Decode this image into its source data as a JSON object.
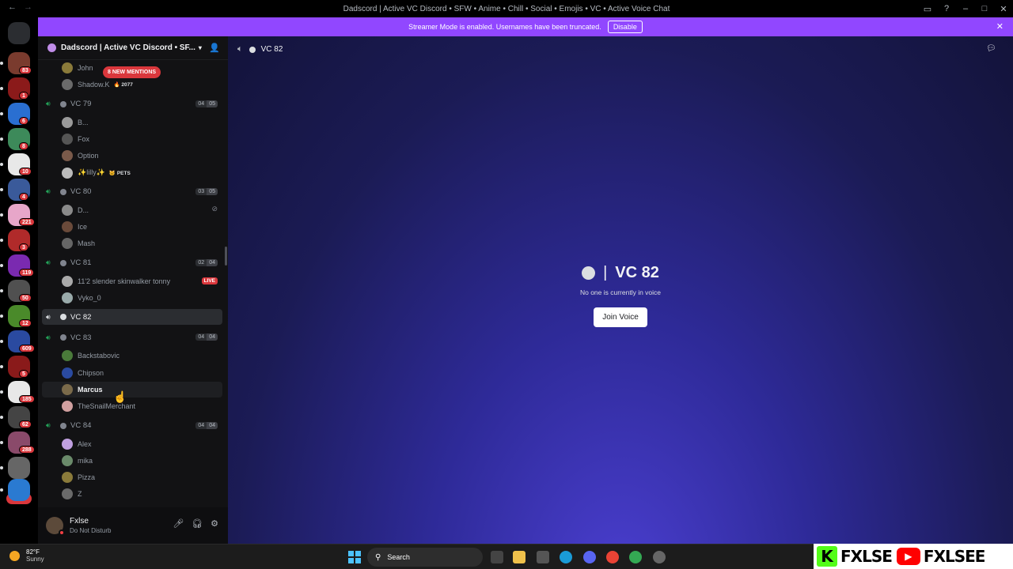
{
  "window": {
    "title": "Dadscord | Active VC Discord • SFW • Anime • Chill • Social • Emojis • VC • Active Voice Chat"
  },
  "banner": {
    "text": "Streamer Mode is enabled. Usernames have been truncated.",
    "button": "Disable"
  },
  "guilds": {
    "badges": [
      "83",
      "1",
      "6",
      "8",
      "10",
      "4",
      "221",
      "3",
      "119",
      "50",
      "12",
      "609",
      "5",
      "185",
      "62",
      "288"
    ],
    "new_label": "NEW"
  },
  "server": {
    "name": "Dadscord | Active VC Discord • SF..."
  },
  "mentions": {
    "label": "8 NEW MENTIONS"
  },
  "list": [
    {
      "type": "user",
      "name": "John"
    },
    {
      "type": "user",
      "name": "Shadow.K",
      "tag": "🔥 2077"
    },
    {
      "type": "channel",
      "name": "VC 79",
      "count_a": "04",
      "count_b": "05"
    },
    {
      "type": "user",
      "name": "B..."
    },
    {
      "type": "user",
      "name": "Fox"
    },
    {
      "type": "user",
      "name": "Option"
    },
    {
      "type": "user",
      "name": "✨lilly✨",
      "tag": "🐱 PETS"
    },
    {
      "type": "channel",
      "name": "VC 80",
      "count_a": "03",
      "count_b": "05"
    },
    {
      "type": "user",
      "name": "D...",
      "muted": true
    },
    {
      "type": "user",
      "name": "Ice"
    },
    {
      "type": "user",
      "name": "Mash"
    },
    {
      "type": "channel",
      "name": "VC 81",
      "count_a": "02",
      "count_b": "04"
    },
    {
      "type": "user",
      "name": "11'2 slender skinwalker tonny",
      "live": "LIVE"
    },
    {
      "type": "user",
      "name": "Vyko_0"
    },
    {
      "type": "channel",
      "name": "VC 82",
      "selected": true
    },
    {
      "type": "channel",
      "name": "VC 83",
      "count_a": "04",
      "count_b": "04"
    },
    {
      "type": "user",
      "name": "Backstabovic"
    },
    {
      "type": "user",
      "name": "Chipson"
    },
    {
      "type": "user",
      "name": "Marcus",
      "hover": true
    },
    {
      "type": "user",
      "name": "TheSnailMerchant"
    },
    {
      "type": "channel",
      "name": "VC 84",
      "count_a": "04",
      "count_b": "04"
    },
    {
      "type": "user",
      "name": "Alex"
    },
    {
      "type": "user",
      "name": "mika"
    },
    {
      "type": "user",
      "name": "Pizza"
    },
    {
      "type": "user",
      "name": "Z"
    }
  ],
  "user_panel": {
    "name": "Fxlse",
    "status": "Do Not Disturb"
  },
  "main": {
    "header": "VC 82",
    "channel_name": "VC 82",
    "separator": "|",
    "empty_text": "No one is currently in voice",
    "join_button": "Join Voice"
  },
  "taskbar": {
    "temp": "82°F",
    "condition": "Sunny",
    "search_placeholder": "Search"
  },
  "brand": {
    "kick_letter": "K",
    "kick_name": "FXLSE",
    "youtube_name": "FXLSEE"
  },
  "colors": {
    "banner": "#9147ff",
    "badge": "#da373c",
    "voice_green": "#23a55a",
    "kick_green": "#53fc18",
    "youtube_red": "#ff0000"
  }
}
